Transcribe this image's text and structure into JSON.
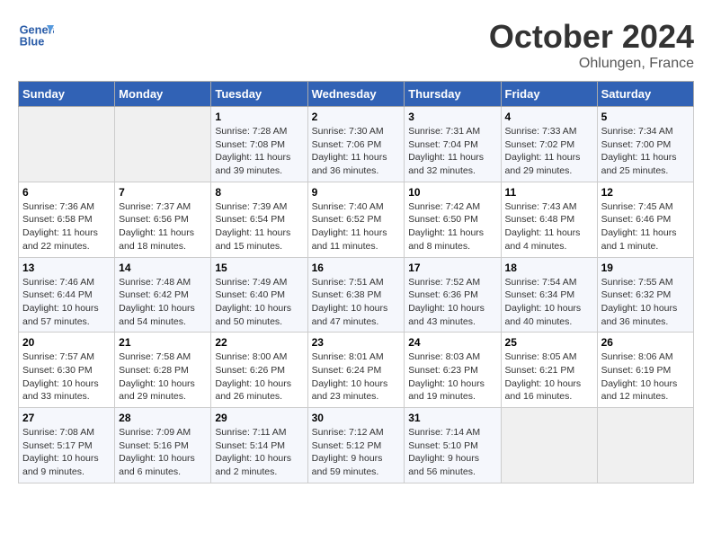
{
  "header": {
    "logo_line1": "General",
    "logo_line2": "Blue",
    "month": "October 2024",
    "location": "Ohlungen, France"
  },
  "weekdays": [
    "Sunday",
    "Monday",
    "Tuesday",
    "Wednesday",
    "Thursday",
    "Friday",
    "Saturday"
  ],
  "weeks": [
    [
      {
        "day": null
      },
      {
        "day": null
      },
      {
        "day": "1",
        "sunrise": "Sunrise: 7:28 AM",
        "sunset": "Sunset: 7:08 PM",
        "daylight": "Daylight: 11 hours and 39 minutes."
      },
      {
        "day": "2",
        "sunrise": "Sunrise: 7:30 AM",
        "sunset": "Sunset: 7:06 PM",
        "daylight": "Daylight: 11 hours and 36 minutes."
      },
      {
        "day": "3",
        "sunrise": "Sunrise: 7:31 AM",
        "sunset": "Sunset: 7:04 PM",
        "daylight": "Daylight: 11 hours and 32 minutes."
      },
      {
        "day": "4",
        "sunrise": "Sunrise: 7:33 AM",
        "sunset": "Sunset: 7:02 PM",
        "daylight": "Daylight: 11 hours and 29 minutes."
      },
      {
        "day": "5",
        "sunrise": "Sunrise: 7:34 AM",
        "sunset": "Sunset: 7:00 PM",
        "daylight": "Daylight: 11 hours and 25 minutes."
      }
    ],
    [
      {
        "day": "6",
        "sunrise": "Sunrise: 7:36 AM",
        "sunset": "Sunset: 6:58 PM",
        "daylight": "Daylight: 11 hours and 22 minutes."
      },
      {
        "day": "7",
        "sunrise": "Sunrise: 7:37 AM",
        "sunset": "Sunset: 6:56 PM",
        "daylight": "Daylight: 11 hours and 18 minutes."
      },
      {
        "day": "8",
        "sunrise": "Sunrise: 7:39 AM",
        "sunset": "Sunset: 6:54 PM",
        "daylight": "Daylight: 11 hours and 15 minutes."
      },
      {
        "day": "9",
        "sunrise": "Sunrise: 7:40 AM",
        "sunset": "Sunset: 6:52 PM",
        "daylight": "Daylight: 11 hours and 11 minutes."
      },
      {
        "day": "10",
        "sunrise": "Sunrise: 7:42 AM",
        "sunset": "Sunset: 6:50 PM",
        "daylight": "Daylight: 11 hours and 8 minutes."
      },
      {
        "day": "11",
        "sunrise": "Sunrise: 7:43 AM",
        "sunset": "Sunset: 6:48 PM",
        "daylight": "Daylight: 11 hours and 4 minutes."
      },
      {
        "day": "12",
        "sunrise": "Sunrise: 7:45 AM",
        "sunset": "Sunset: 6:46 PM",
        "daylight": "Daylight: 11 hours and 1 minute."
      }
    ],
    [
      {
        "day": "13",
        "sunrise": "Sunrise: 7:46 AM",
        "sunset": "Sunset: 6:44 PM",
        "daylight": "Daylight: 10 hours and 57 minutes."
      },
      {
        "day": "14",
        "sunrise": "Sunrise: 7:48 AM",
        "sunset": "Sunset: 6:42 PM",
        "daylight": "Daylight: 10 hours and 54 minutes."
      },
      {
        "day": "15",
        "sunrise": "Sunrise: 7:49 AM",
        "sunset": "Sunset: 6:40 PM",
        "daylight": "Daylight: 10 hours and 50 minutes."
      },
      {
        "day": "16",
        "sunrise": "Sunrise: 7:51 AM",
        "sunset": "Sunset: 6:38 PM",
        "daylight": "Daylight: 10 hours and 47 minutes."
      },
      {
        "day": "17",
        "sunrise": "Sunrise: 7:52 AM",
        "sunset": "Sunset: 6:36 PM",
        "daylight": "Daylight: 10 hours and 43 minutes."
      },
      {
        "day": "18",
        "sunrise": "Sunrise: 7:54 AM",
        "sunset": "Sunset: 6:34 PM",
        "daylight": "Daylight: 10 hours and 40 minutes."
      },
      {
        "day": "19",
        "sunrise": "Sunrise: 7:55 AM",
        "sunset": "Sunset: 6:32 PM",
        "daylight": "Daylight: 10 hours and 36 minutes."
      }
    ],
    [
      {
        "day": "20",
        "sunrise": "Sunrise: 7:57 AM",
        "sunset": "Sunset: 6:30 PM",
        "daylight": "Daylight: 10 hours and 33 minutes."
      },
      {
        "day": "21",
        "sunrise": "Sunrise: 7:58 AM",
        "sunset": "Sunset: 6:28 PM",
        "daylight": "Daylight: 10 hours and 29 minutes."
      },
      {
        "day": "22",
        "sunrise": "Sunrise: 8:00 AM",
        "sunset": "Sunset: 6:26 PM",
        "daylight": "Daylight: 10 hours and 26 minutes."
      },
      {
        "day": "23",
        "sunrise": "Sunrise: 8:01 AM",
        "sunset": "Sunset: 6:24 PM",
        "daylight": "Daylight: 10 hours and 23 minutes."
      },
      {
        "day": "24",
        "sunrise": "Sunrise: 8:03 AM",
        "sunset": "Sunset: 6:23 PM",
        "daylight": "Daylight: 10 hours and 19 minutes."
      },
      {
        "day": "25",
        "sunrise": "Sunrise: 8:05 AM",
        "sunset": "Sunset: 6:21 PM",
        "daylight": "Daylight: 10 hours and 16 minutes."
      },
      {
        "day": "26",
        "sunrise": "Sunrise: 8:06 AM",
        "sunset": "Sunset: 6:19 PM",
        "daylight": "Daylight: 10 hours and 12 minutes."
      }
    ],
    [
      {
        "day": "27",
        "sunrise": "Sunrise: 7:08 AM",
        "sunset": "Sunset: 5:17 PM",
        "daylight": "Daylight: 10 hours and 9 minutes."
      },
      {
        "day": "28",
        "sunrise": "Sunrise: 7:09 AM",
        "sunset": "Sunset: 5:16 PM",
        "daylight": "Daylight: 10 hours and 6 minutes."
      },
      {
        "day": "29",
        "sunrise": "Sunrise: 7:11 AM",
        "sunset": "Sunset: 5:14 PM",
        "daylight": "Daylight: 10 hours and 2 minutes."
      },
      {
        "day": "30",
        "sunrise": "Sunrise: 7:12 AM",
        "sunset": "Sunset: 5:12 PM",
        "daylight": "Daylight: 9 hours and 59 minutes."
      },
      {
        "day": "31",
        "sunrise": "Sunrise: 7:14 AM",
        "sunset": "Sunset: 5:10 PM",
        "daylight": "Daylight: 9 hours and 56 minutes."
      },
      {
        "day": null
      },
      {
        "day": null
      }
    ]
  ]
}
